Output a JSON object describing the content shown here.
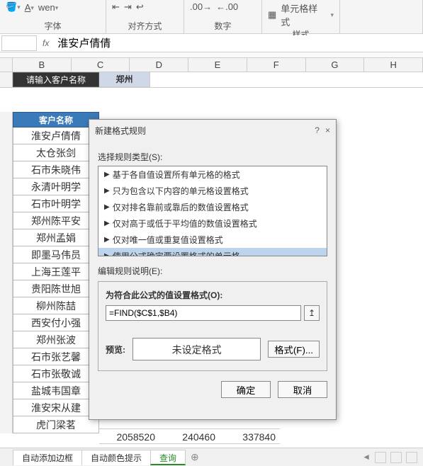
{
  "ribbon": {
    "font_label": "字体",
    "align_label": "对齐方式",
    "number_label": "数字",
    "style_label": "样式",
    "cell_style": "单元格样式",
    "wen_tag": "wen"
  },
  "formula_bar": {
    "fx": "fx",
    "value": "淮安卢倩倩"
  },
  "columns": [
    "B",
    "C",
    "D",
    "E",
    "F",
    "G",
    "H"
  ],
  "prompt": {
    "label": "请输入客户名称",
    "value": "郑州"
  },
  "table": {
    "header": "客户名称",
    "names": [
      "淮安卢倩倩",
      "太仓张剑",
      "石市朱晓伟",
      "永清叶明学",
      "石市叶明学",
      "郑州陈平安",
      "郑州孟娟",
      "即墨马伟员",
      "上海王莲平",
      "贵阳陈世旭",
      "柳州陈喆",
      "西安付小强",
      "郑州张波",
      "石市张艺馨",
      "石市张敬诚",
      "盐城韦国章",
      "淮安宋从建",
      "虎门梁茗"
    ]
  },
  "bottom_numbers": [
    "2058520",
    "240460",
    "337840"
  ],
  "dialog": {
    "title": "新建格式规则",
    "help_icon": "?",
    "close_icon": "×",
    "select_rule_type": "选择规则类型(S):",
    "rules": [
      "基于各自值设置所有单元格的格式",
      "只为包含以下内容的单元格设置格式",
      "仅对排名靠前或靠后的数值设置格式",
      "仅对高于或低于平均值的数值设置格式",
      "仅对唯一值或重复值设置格式",
      "使用公式确定要设置格式的单元格"
    ],
    "edit_rule_desc": "编辑规则说明(E):",
    "formula_label": "为符合此公式的值设置格式(O):",
    "formula_value": "=FIND($C$1,$B4)",
    "ref_icon": "↥",
    "preview_label": "预览:",
    "preview_text": "未设定格式",
    "format_btn": "格式(F)...",
    "ok": "确定",
    "cancel": "取消"
  },
  "sheets": {
    "tabs": [
      "自动添加边框",
      "自动颜色提示",
      "查询"
    ],
    "add_icon": "⊕",
    "nav_left": "◄"
  }
}
